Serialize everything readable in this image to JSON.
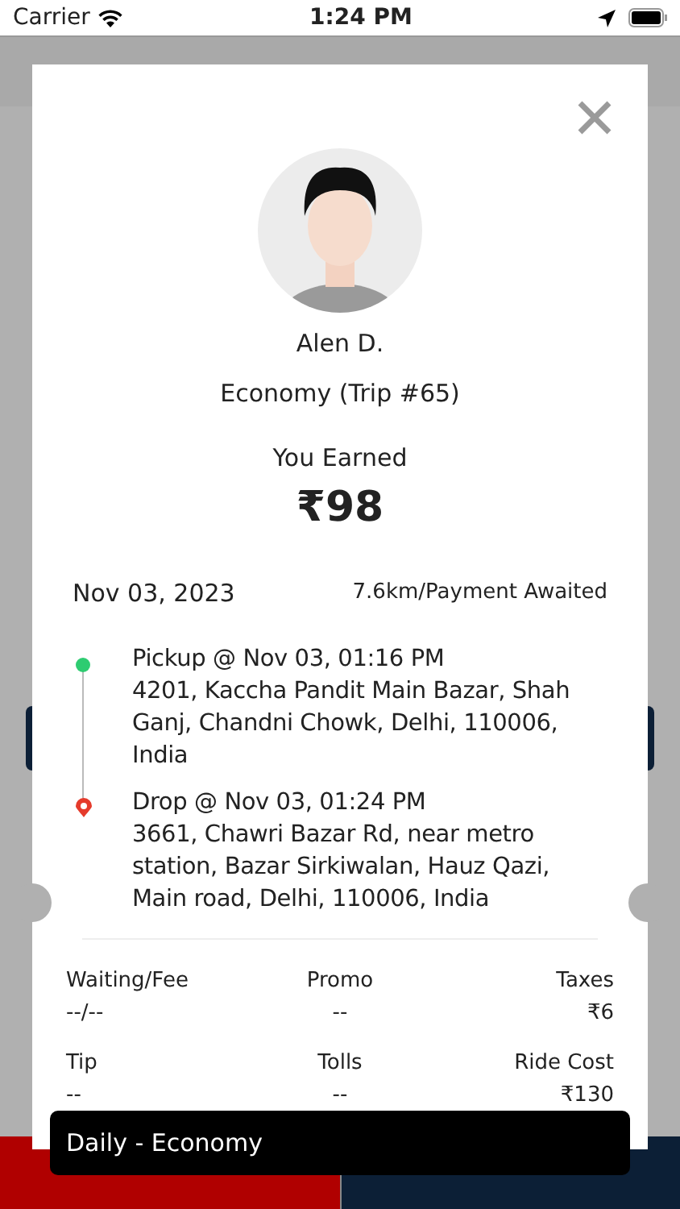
{
  "status_bar": {
    "carrier": "Carrier",
    "time": "1:24 PM"
  },
  "rider": {
    "name": "Alen D.",
    "trip": "Economy (Trip #65)"
  },
  "earning": {
    "label": "You Earned",
    "amount": "₹98"
  },
  "trip": {
    "date": "Nov 03, 2023",
    "summary": "7.6km/Payment Awaited"
  },
  "stops": [
    {
      "kind": "pickup",
      "title": "Pickup @ Nov 03, 01:16 PM",
      "address": "4201, Kaccha Pandit Main Bazar, Shah Ganj, Chandni Chowk, Delhi, 110006, India"
    },
    {
      "kind": "drop",
      "title": "Drop @ Nov 03, 01:24 PM",
      "address": "3661, Chawri Bazar Rd, near metro station, Bazar Sirkiwalan, Hauz Qazi, Main road, Delhi, 110006, India"
    }
  ],
  "fares": [
    {
      "label": "Waiting/Fee",
      "value": "--/--"
    },
    {
      "label": "Promo",
      "value": "--"
    },
    {
      "label": "Taxes",
      "value": "₹6"
    },
    {
      "label": "Tip",
      "value": "--"
    },
    {
      "label": "Tolls",
      "value": "--"
    },
    {
      "label": "Ride Cost",
      "value": "₹130"
    }
  ],
  "toast": {
    "text": "Daily - Economy"
  }
}
